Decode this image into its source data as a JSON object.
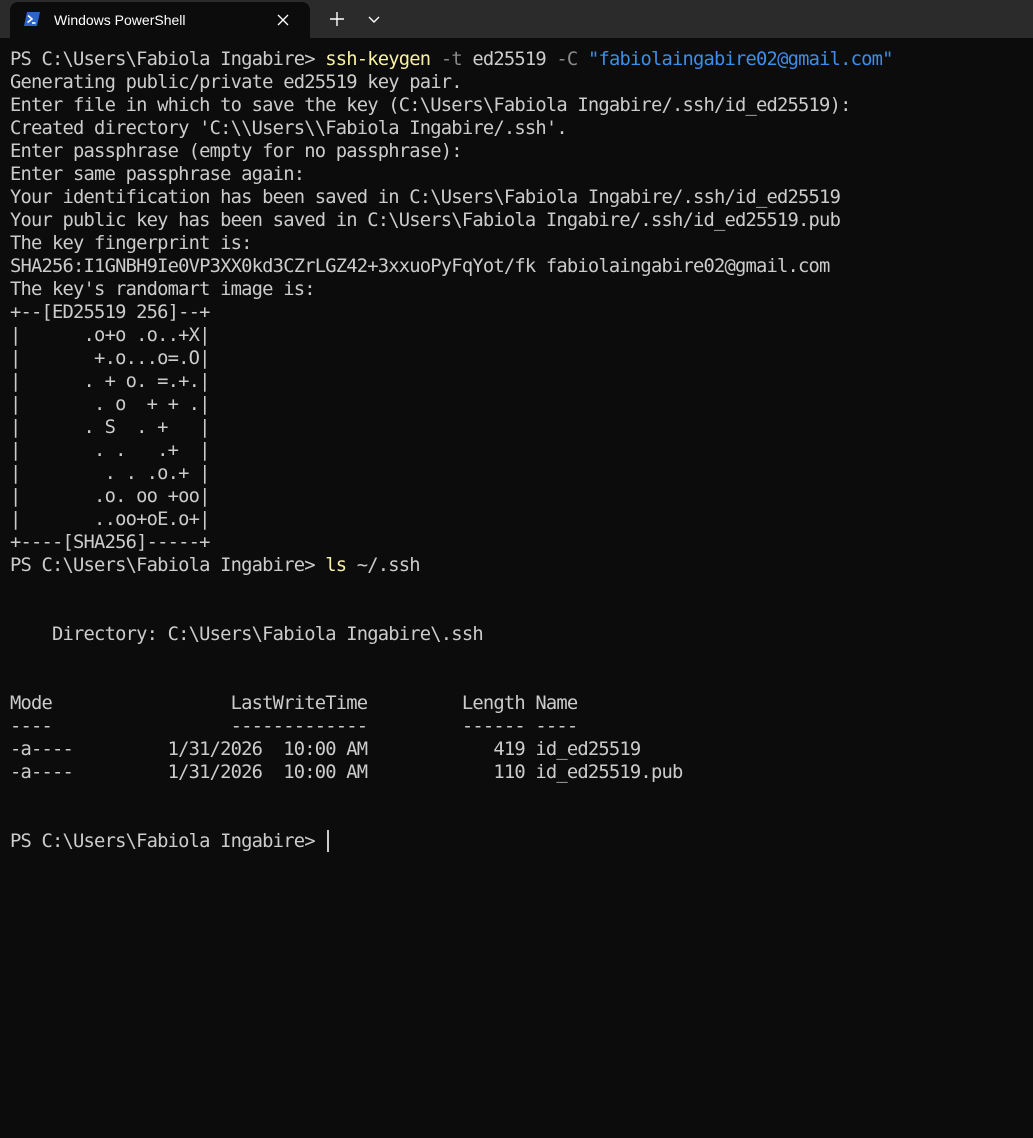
{
  "window": {
    "tab_title": "Windows PowerShell",
    "tab_icon": "powershell-icon",
    "close_icon": "close-icon",
    "new_tab_icon": "plus-icon",
    "dropdown_icon": "chevron-down-icon"
  },
  "colors": {
    "background": "#0c0c0c",
    "titlebar": "#2b2b2b",
    "text": "#cccccc",
    "command": "#f9f1a5",
    "parameter": "#8a8a8a",
    "string": "#3b8eea"
  },
  "terminal": {
    "session1": {
      "prompt": "PS C:\\Users\\Fabiola Ingabire> ",
      "command": "ssh-keygen",
      "arg1_flag": "-t",
      "arg1_value": " ed25519 ",
      "arg2_flag": "-C",
      "arg2_value": "\"fabiolaingabire02@gmail.com\""
    },
    "keygen_output": [
      "Generating public/private ed25519 key pair.",
      "Enter file in which to save the key (C:\\Users\\Fabiola Ingabire/.ssh/id_ed25519):",
      "Created directory 'C:\\\\Users\\\\Fabiola Ingabire/.ssh'.",
      "Enter passphrase (empty for no passphrase):",
      "Enter same passphrase again:",
      "Your identification has been saved in C:\\Users\\Fabiola Ingabire/.ssh/id_ed25519",
      "Your public key has been saved in C:\\Users\\Fabiola Ingabire/.ssh/id_ed25519.pub",
      "The key fingerprint is:",
      "SHA256:I1GNBH9Ie0VP3XX0kd3CZrLGZ42+3xxuoPyFqYot/fk fabiolaingabire02@gmail.com",
      "The key's randomart image is:"
    ],
    "randomart": [
      "+--[ED25519 256]--+",
      "|      .o+o .o..+X|",
      "|       +.o...o=.O|",
      "|      . + o. =.+.|",
      "|       . o  + + .|",
      "|      . S  . +   |",
      "|       . .   .+  |",
      "|        . . .o.+ |",
      "|       .o. oo +oo|",
      "|       ..oo+oE.o+|",
      "+----[SHA256]-----+"
    ],
    "session2": {
      "prompt": "PS C:\\Users\\Fabiola Ingabire> ",
      "command": "ls",
      "arg": " ~/.ssh"
    },
    "ls_output": {
      "directory_line": "    Directory: C:\\Users\\Fabiola Ingabire\\.ssh",
      "header": "Mode                 LastWriteTime         Length Name",
      "separator": "----                 -------------         ------ ----",
      "rows": [
        "-a----         1/31/2026  10:00 AM            419 id_ed25519",
        "-a----         1/31/2026  10:00 AM            110 id_ed25519.pub"
      ]
    },
    "final_prompt": "PS C:\\Users\\Fabiola Ingabire> "
  }
}
